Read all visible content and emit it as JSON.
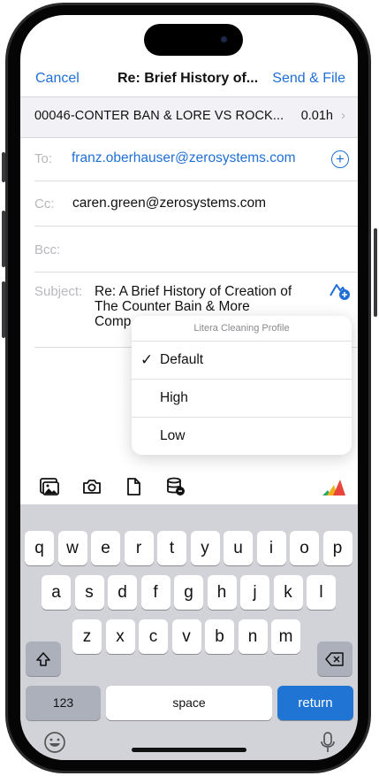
{
  "nav": {
    "cancel": "Cancel",
    "title": "Re: Brief History of...",
    "send": "Send & File"
  },
  "matter": {
    "text": "00046-CONTER BAN & LORE VS ROCK...",
    "time": "0.01h",
    "chevron": "›"
  },
  "to": {
    "label": "To:",
    "value": "franz.oberhauser@zerosystems.com"
  },
  "cc": {
    "label": "Cc:",
    "value": "caren.green@zerosystems.com"
  },
  "bcc": {
    "label": "Bcc:"
  },
  "subject": {
    "label": "Subject:",
    "line1": "Re: A Brief History of Creation of",
    "line2": "The Counter Bain & More",
    "line3": "Comp"
  },
  "menu": {
    "header": "Litera Cleaning Profile",
    "items": [
      {
        "label": "Default",
        "checked": true,
        "check": "✓"
      },
      {
        "label": "High"
      },
      {
        "label": "Low"
      }
    ]
  },
  "toolbar": {
    "icons": [
      "photo-library-icon",
      "camera-icon",
      "document-icon",
      "database-sync-icon",
      "litera-logo-icon"
    ]
  },
  "keyboard": {
    "row1": [
      "q",
      "w",
      "e",
      "r",
      "t",
      "y",
      "u",
      "i",
      "o",
      "p"
    ],
    "row2": [
      "a",
      "s",
      "d",
      "f",
      "g",
      "h",
      "j",
      "k",
      "l"
    ],
    "row3": [
      "z",
      "x",
      "c",
      "v",
      "b",
      "n",
      "m"
    ],
    "numbers": "123",
    "space": "space",
    "return": "return"
  },
  "colors": {
    "accent": "#1f6fd6",
    "return_key": "#1f74d4"
  }
}
